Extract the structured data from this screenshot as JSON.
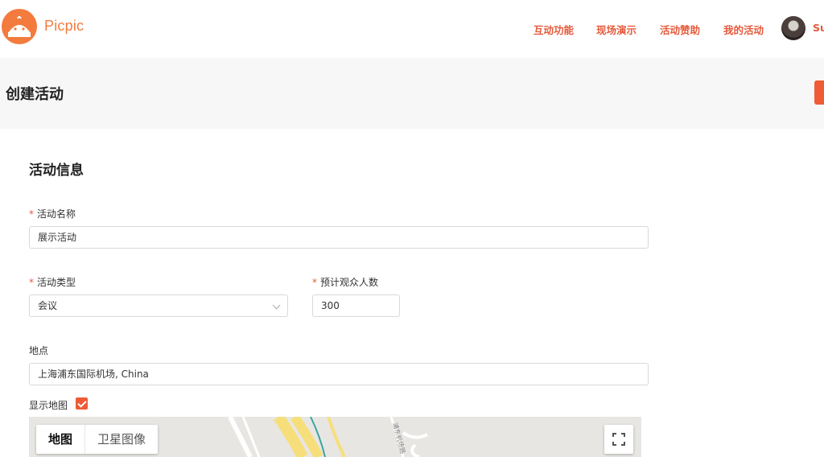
{
  "brand": {
    "name": "Picpic",
    "logo_icon": "android-robot-icon"
  },
  "nav": {
    "items": [
      "互动功能",
      "现场演示",
      "活动赞助",
      "我的活动"
    ],
    "username": "Su"
  },
  "page": {
    "title": "创建活动"
  },
  "form": {
    "section_title": "活动信息",
    "required_mark": "*",
    "name_label": "活动名称",
    "name_value": "展示活动",
    "type_label": "活动类型",
    "type_value": "会议",
    "audience_label": "预计观众人数",
    "audience_value": "300",
    "location_label": "地点",
    "location_value": "上海浦东国际机场, China",
    "show_map_label": "显示地图",
    "show_map_checked": true
  },
  "map": {
    "type_map": "地图",
    "type_satellite": "卫星图像",
    "road_label": "浦东机场路"
  },
  "colors": {
    "accent": "#ee5b36",
    "brand": "#f37b3d"
  }
}
